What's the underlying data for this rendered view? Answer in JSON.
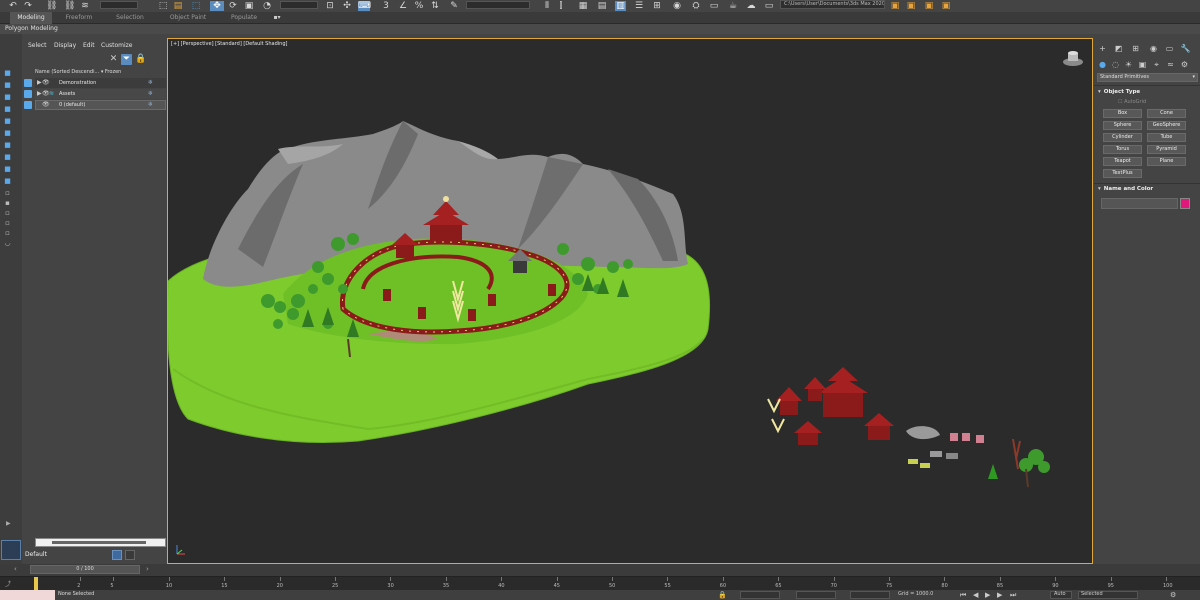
{
  "toolbar": {
    "path_text": "C:\\Users\\User\\Documents\\3ds Max 2020"
  },
  "ribbon": {
    "tabs": [
      "Modeling",
      "Freeform",
      "Selection",
      "Object Paint",
      "Populate"
    ],
    "active_tab": "Modeling",
    "sub_label": "Polygon Modeling"
  },
  "explorer": {
    "menu": [
      "Select",
      "Display",
      "Edit",
      "Customize"
    ],
    "header": "Name (Sorted Descendi... ▾ Frozen",
    "rows": [
      {
        "name": "Demonstration"
      },
      {
        "name": "Assets"
      },
      {
        "name": "0 (default)"
      }
    ],
    "layer": "Default"
  },
  "viewport": {
    "label": "[+] [Perspective] [Standard] [Default Shading]",
    "colors": {
      "grass": "#7ecb2e",
      "rock": "#8a8a8a",
      "roof": "#8b1a1a",
      "tree": "#3f9a2e"
    }
  },
  "command_panel": {
    "dropdown": "Standard Primitives",
    "object_type_title": "Object Type",
    "autogrid": "AutoGrid",
    "primitives": [
      "Box",
      "Cone",
      "Sphere",
      "GeoSphere",
      "Cylinder",
      "Tube",
      "Torus",
      "Pyramid",
      "Teapot",
      "Plane",
      "TextPlus"
    ],
    "name_color_title": "Name and Color",
    "color": "#e0187c"
  },
  "timeline": {
    "slider": "0 / 100",
    "ticks": [
      "2",
      "5",
      "10",
      "15",
      "20",
      "25",
      "30",
      "35",
      "40",
      "45",
      "50",
      "55",
      "60",
      "65",
      "70",
      "75",
      "80",
      "85",
      "90",
      "95",
      "100"
    ]
  },
  "status": {
    "selection": "None Selected",
    "grid": "Grid = 1000.0",
    "auto": "Auto",
    "selected": "Selected"
  }
}
